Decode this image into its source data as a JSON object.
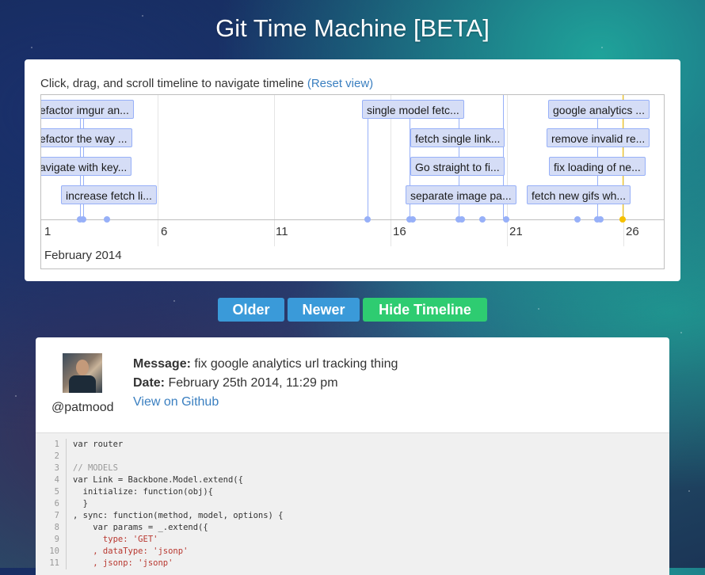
{
  "app": {
    "title": "Git Time Machine [BETA]"
  },
  "timeline": {
    "instructions": "Click, drag, and scroll timeline to navigate timeline",
    "reset_link": "(Reset view)",
    "month_label": "February 2014",
    "ticks": [
      "1",
      "6",
      "11",
      "16",
      "21",
      "26"
    ],
    "items": [
      {
        "label": "efactor imgur an..."
      },
      {
        "label": "efactor the way ..."
      },
      {
        "label": "avigate with key..."
      },
      {
        "label": "increase fetch li..."
      },
      {
        "label": "single model fetc..."
      },
      {
        "label": "fetch single link..."
      },
      {
        "label": "Go straight to fi..."
      },
      {
        "label": "separate image pa..."
      },
      {
        "label": "google analytics ..."
      },
      {
        "label": "remove invalid re..."
      },
      {
        "label": "fix loading of ne..."
      },
      {
        "label": "fetch new gifs wh..."
      }
    ]
  },
  "buttons": {
    "older": "Older",
    "newer": "Newer",
    "hide_timeline": "Hide Timeline"
  },
  "commit": {
    "username": "@patmood",
    "message_label": "Message:",
    "message": "fix google analytics url tracking thing",
    "date_label": "Date:",
    "date": "February 25th 2014, 11:29 pm",
    "github_link": "View on Github"
  },
  "code": {
    "line_numbers": [
      "1",
      "2",
      "3",
      "4",
      "5",
      "6",
      "7",
      "8",
      "9",
      "10",
      "11"
    ],
    "lines": [
      "var router",
      "",
      "// MODELS",
      "var Link = Backbone.Model.extend({",
      "  initialize: function(obj){",
      "  }",
      ", sync: function(method, model, options) {",
      "    var params = _.extend({",
      "      type: 'GET'",
      "    , dataType: 'jsonp'",
      "    , jsonp: 'jsonp'"
    ]
  },
  "colors": {
    "item_bg": "#d5ddf6",
    "item_border": "#97b0f8",
    "active_marker": "#f5c000",
    "btn_blue": "#3a9ad9",
    "btn_green": "#2ecc71",
    "link": "#3a7fc0"
  }
}
